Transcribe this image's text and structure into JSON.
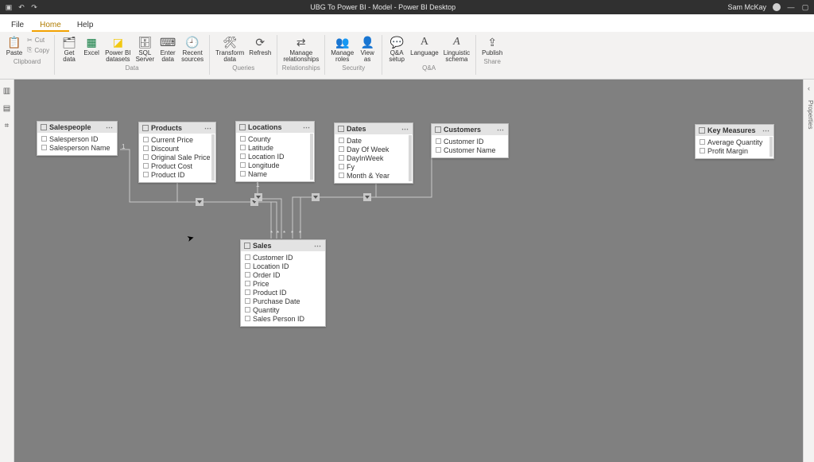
{
  "titlebar": {
    "title": "UBG To Power BI - Model - Power BI Desktop",
    "user": "Sam McKay"
  },
  "menu": {
    "file": "File",
    "home": "Home",
    "help": "Help"
  },
  "ribbon": {
    "clipboard": {
      "paste": "Paste",
      "cut": "Cut",
      "copy": "Copy",
      "label": "Clipboard"
    },
    "data": {
      "getdata": "Get\ndata",
      "excel": "Excel",
      "pbidata": "Power BI\ndatasets",
      "sql": "SQL\nServer",
      "enter": "Enter\ndata",
      "recent": "Recent\nsources",
      "label": "Data"
    },
    "queries": {
      "transform": "Transform\ndata",
      "refresh": "Refresh",
      "label": "Queries"
    },
    "relationships": {
      "manage": "Manage\nrelationships",
      "label": "Relationships"
    },
    "security": {
      "roles": "Manage\nroles",
      "viewas": "View\nas",
      "label": "Security"
    },
    "qa": {
      "qasetup": "Q&A\nsetup",
      "lang": "Language",
      "ling": "Linguistic\nschema",
      "label": "Q&A"
    },
    "share": {
      "publish": "Publish",
      "label": "Share"
    }
  },
  "rightpane": {
    "label": "Properties",
    "chev": "‹"
  },
  "tables": {
    "salespeople": {
      "title": "Salespeople",
      "fields": [
        "Salesperson ID",
        "Salesperson Name"
      ]
    },
    "products": {
      "title": "Products",
      "fields": [
        "Current Price",
        "Discount",
        "Original Sale Price",
        "Product Cost",
        "Product ID"
      ]
    },
    "locations": {
      "title": "Locations",
      "fields": [
        "County",
        "Latitude",
        "Location ID",
        "Longitude",
        "Name"
      ]
    },
    "dates": {
      "title": "Dates",
      "fields": [
        "Date",
        "Day Of Week",
        "DayInWeek",
        "Fy",
        "Month & Year"
      ]
    },
    "customers": {
      "title": "Customers",
      "fields": [
        "Customer ID",
        "Customer Name"
      ]
    },
    "keymeasures": {
      "title": "Key Measures",
      "fields": [
        "Average Quantity",
        "Profit Margin"
      ]
    },
    "sales": {
      "title": "Sales",
      "fields": [
        "Customer ID",
        "Location ID",
        "Order ID",
        "Price",
        "Product ID",
        "Purchase Date",
        "Quantity",
        "Sales Person ID"
      ]
    }
  },
  "chart_data": {
    "type": "table",
    "title": "Power BI Data Model (Star Schema)",
    "fact_table": "Sales",
    "dimension_tables": [
      "Salespeople",
      "Products",
      "Locations",
      "Dates",
      "Customers"
    ],
    "standalone_tables": [
      "Key Measures"
    ],
    "relationships": [
      {
        "from": "Salespeople",
        "to": "Sales",
        "cardinality": "1:*"
      },
      {
        "from": "Products",
        "to": "Sales",
        "cardinality": "1:*"
      },
      {
        "from": "Locations",
        "to": "Sales",
        "cardinality": "1:*"
      },
      {
        "from": "Dates",
        "to": "Sales",
        "cardinality": "1:*"
      },
      {
        "from": "Customers",
        "to": "Sales",
        "cardinality": "1:*"
      }
    ]
  }
}
